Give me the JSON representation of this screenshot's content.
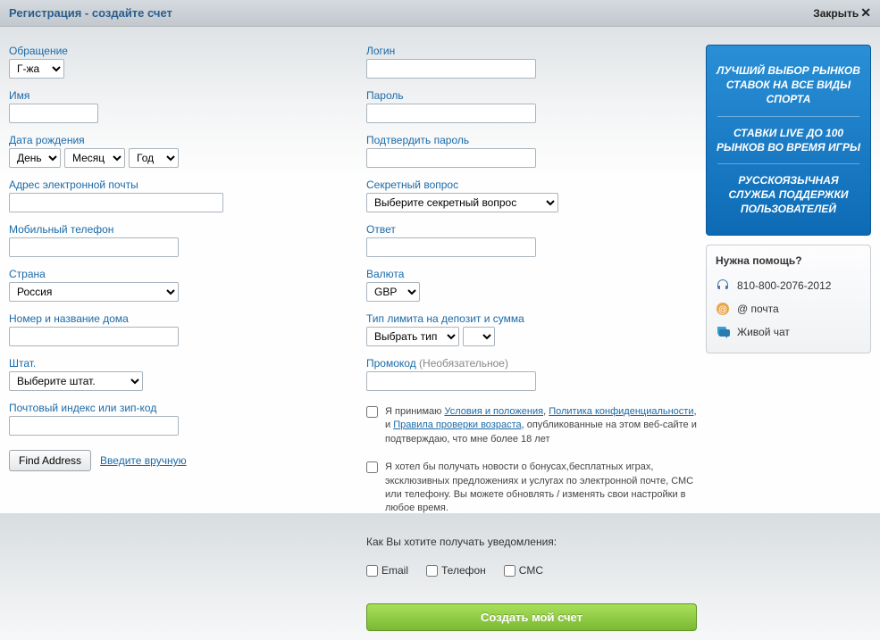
{
  "header": {
    "title": "Регистрация - создайте счет",
    "close": "Закрыть"
  },
  "left": {
    "salutation_label": "Обращение",
    "salutation_value": "Г-жа",
    "name_label": "Имя",
    "dob_label": "Дата рождения",
    "dob_day": "День",
    "dob_month": "Месяц",
    "dob_year": "Год",
    "email_label": "Адрес электронной почты",
    "mobile_label": "Мобильный телефон",
    "country_label": "Страна",
    "country_value": "Россия",
    "house_label": "Номер и название дома",
    "state_label": "Штат.",
    "state_value": "Выберите штат.",
    "postcode_label": "Почтовый индекс или зип-код",
    "find_address": "Find Address",
    "manual_enter": "Введите вручную"
  },
  "right": {
    "login_label": "Логин",
    "password_label": "Пароль",
    "confirm_label": "Подтвердить пароль",
    "secret_q_label": "Секретный вопрос",
    "secret_q_value": "Выберите секретный вопрос",
    "answer_label": "Ответ",
    "currency_label": "Валюта",
    "currency_value": "GBP",
    "limit_label": "Тип лимита на депозит и сумма",
    "limit_value": "Выбрать тип",
    "promo_label": "Промокод",
    "promo_optional": "(Необязательное)",
    "terms_prefix": "Я принимаю ",
    "terms_link1": "Условия и положения",
    "terms_sep1": ", ",
    "terms_link2": "Политика конфиденциальности",
    "terms_sep2": ", и ",
    "terms_link3": "Правила проверки возраста",
    "terms_suffix": ", опубликованные на этом веб-сайте и подтверждаю, что мне более 18 лет",
    "optin_text": "Я хотел бы получать новости о бонусах,бесплатных играх, эксклюзивных предложениях и услугах по электронной почте, СМС или телефону. Вы можете обновлять / изменять свои настройки в любое время.",
    "notif_title": "Как Вы хотите получать уведомления:",
    "notif_email": "Email",
    "notif_phone": "Телефон",
    "notif_sms": "СМС",
    "submit": "Создать мой счет"
  },
  "sidebar": {
    "promo1": "ЛУЧШИЙ ВЫБОР РЫНКОВ СТАВОК НА ВСЕ ВИДЫ СПОРТА",
    "promo2": "СТАВКИ LIVE ДО 100 РЫНКОВ ВО ВРЕМЯ ИГРЫ",
    "promo3": "РУССКОЯЗЫЧНАЯ СЛУЖБА ПОДДЕРЖКИ ПОЛЬЗОВАТЕЛЕЙ",
    "help_title": "Нужна помощь?",
    "help_phone": "810-800-2076-2012",
    "help_email": "@ почта",
    "help_chat": "Живой чат"
  }
}
